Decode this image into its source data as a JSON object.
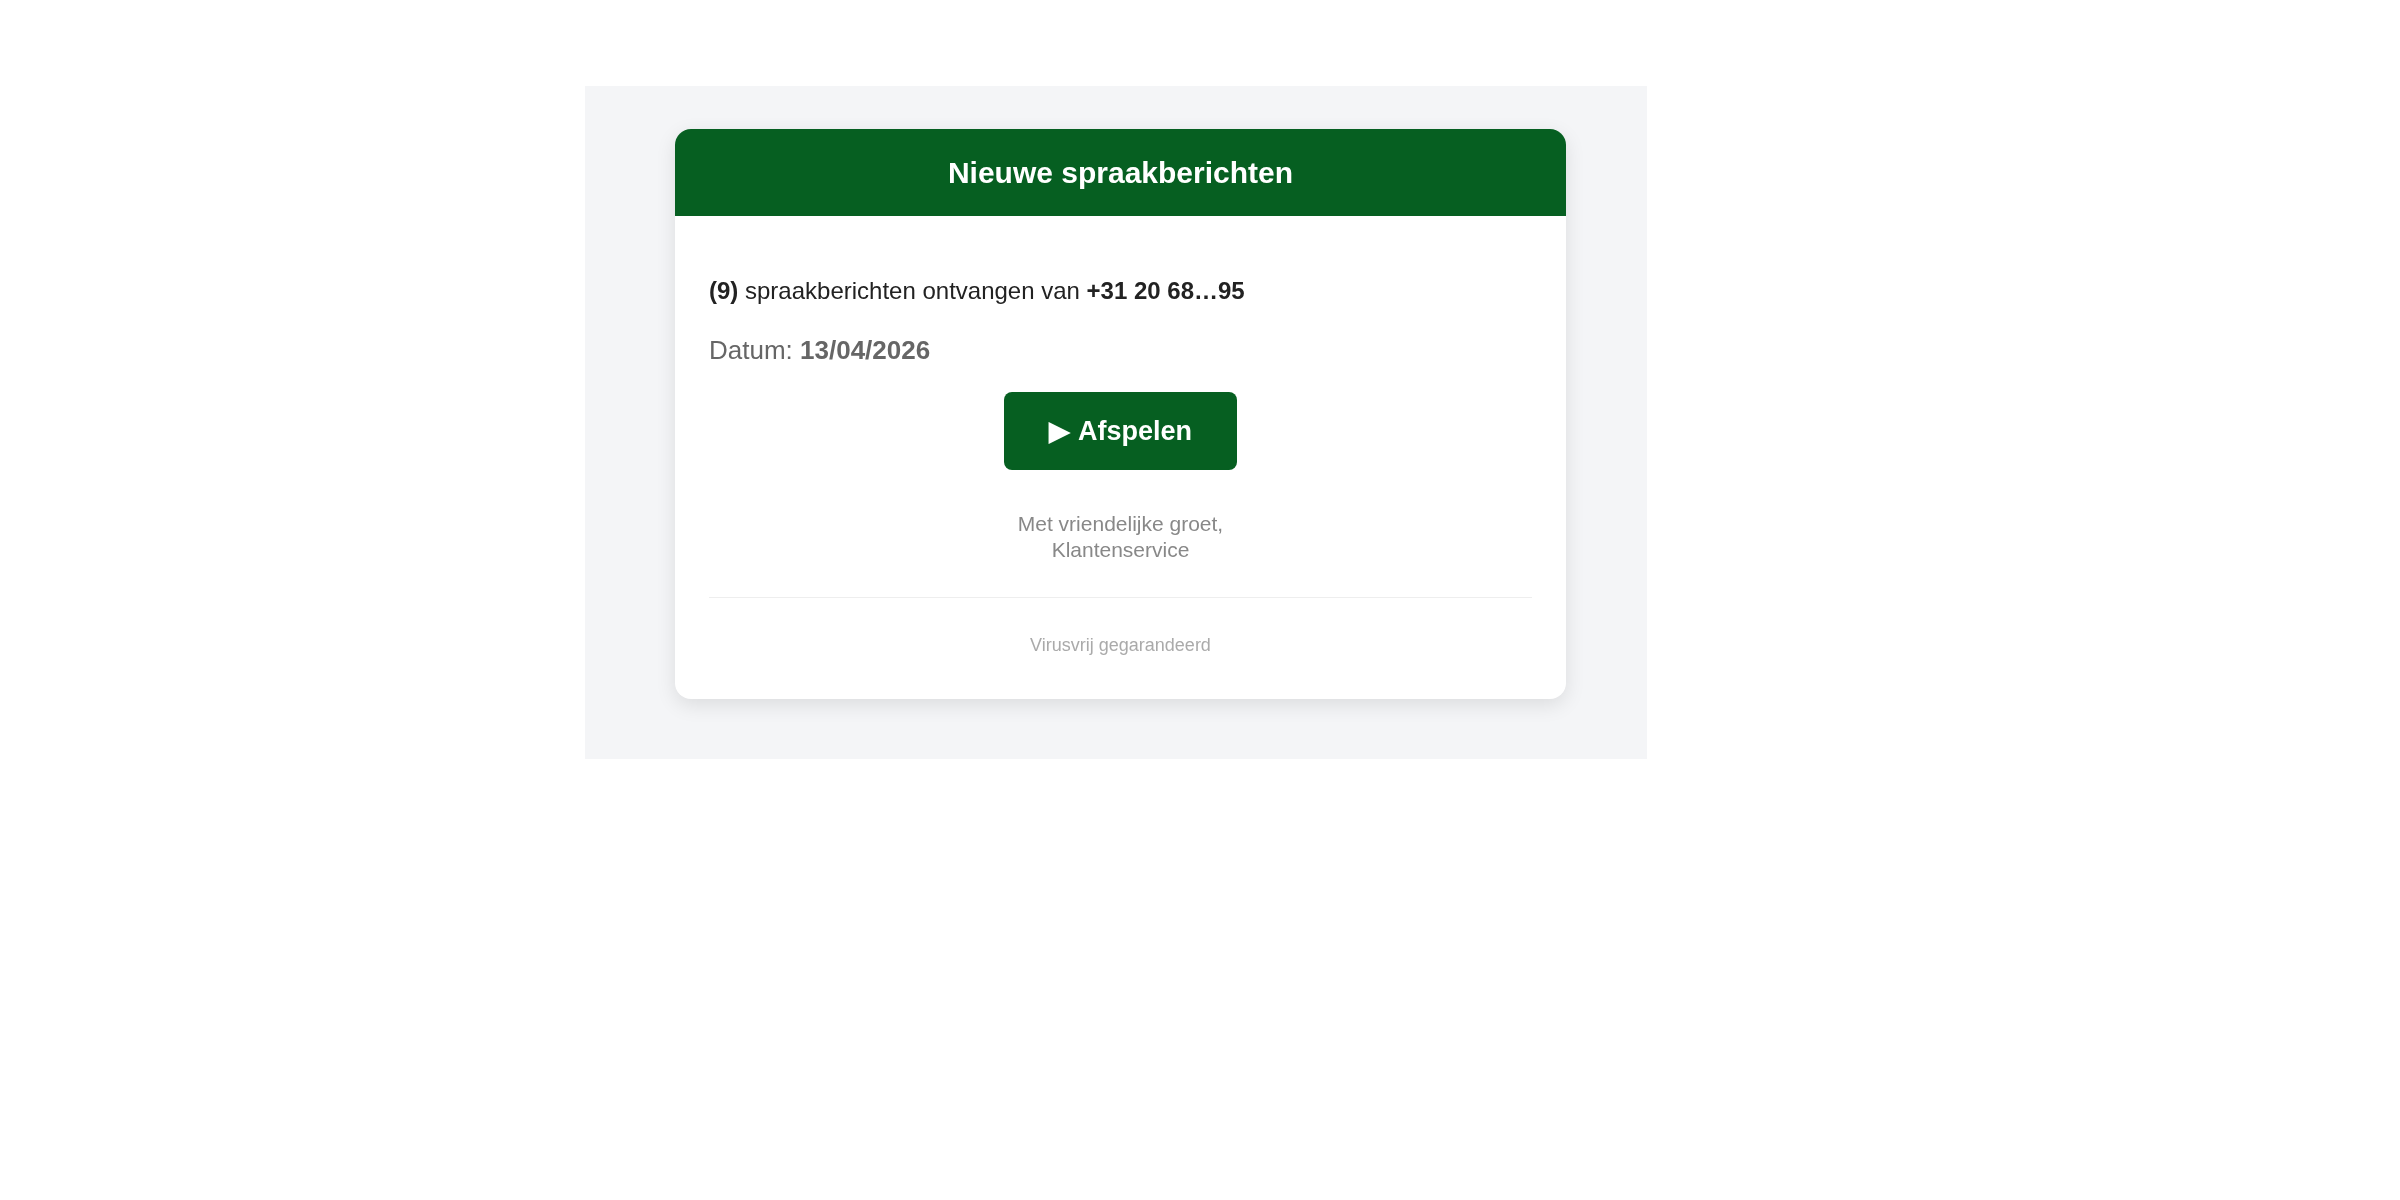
{
  "card": {
    "title": "Nieuwe spraakberichten",
    "message": "**(9)** spraakberichten ontvangen van **+31 20 68…95**",
    "date": "Datum: **13/04/2026**",
    "button": {
      "icon": "▶",
      "label": "Afspelen"
    },
    "signature": [
      "Met vriendelijke groet,",
      "Klantenservice"
    ],
    "footer": "Virusvrij gegarandeerd"
  }
}
